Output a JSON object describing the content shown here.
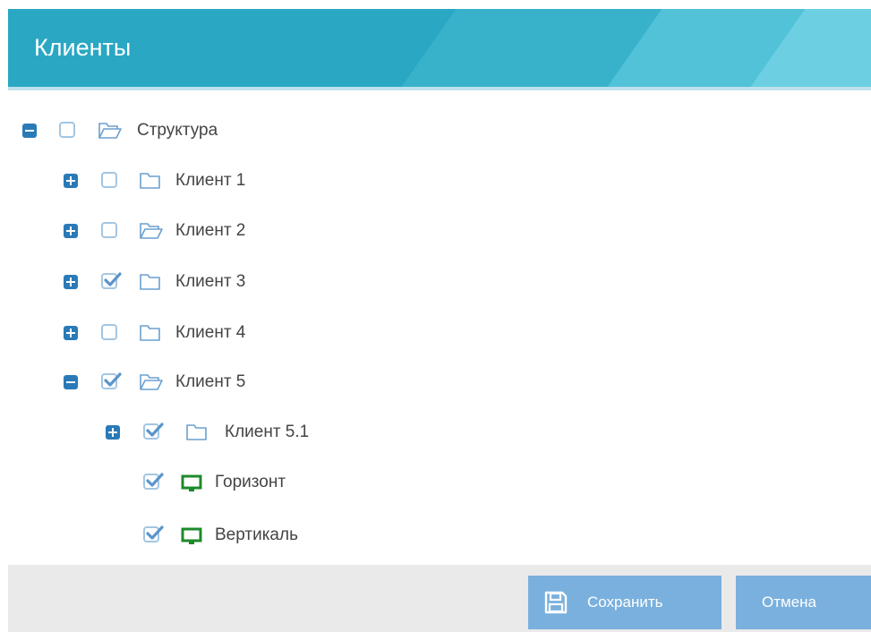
{
  "dialog": {
    "title": "Клиенты"
  },
  "tree": {
    "nodes": [
      {
        "label": "Структура",
        "toggle": "minus",
        "checked": false,
        "icon": "folder-open-icon"
      },
      {
        "label": "Клиент 1",
        "toggle": "plus",
        "checked": false,
        "icon": "folder-icon"
      },
      {
        "label": "Клиент 2",
        "toggle": "plus",
        "checked": false,
        "icon": "folder-open-icon"
      },
      {
        "label": "Клиент 3",
        "toggle": "plus",
        "checked": true,
        "icon": "folder-icon"
      },
      {
        "label": "Клиент 4",
        "toggle": "plus",
        "checked": false,
        "icon": "folder-icon"
      },
      {
        "label": "Клиент 5",
        "toggle": "minus",
        "checked": true,
        "icon": "folder-open-icon"
      },
      {
        "label": "Клиент 5.1",
        "toggle": "plus",
        "checked": true,
        "icon": "folder-icon"
      },
      {
        "label": "Горизонт",
        "toggle": "none",
        "checked": true,
        "icon": "monitor-icon"
      },
      {
        "label": "Вертикаль",
        "toggle": "none",
        "checked": true,
        "icon": "monitor-icon"
      }
    ]
  },
  "footer": {
    "save_label": "Сохранить",
    "cancel_label": "Отмена"
  },
  "colors": {
    "header": "#2aa7c3",
    "toggle": "#2a7ab8",
    "checkbox_border": "#a3c6e2",
    "checkmark": "#5b95c9",
    "folder": "#6a9fd0",
    "monitor": "#1d8a2a",
    "button": "#7ab0dd",
    "footer": "#eaeaea"
  }
}
